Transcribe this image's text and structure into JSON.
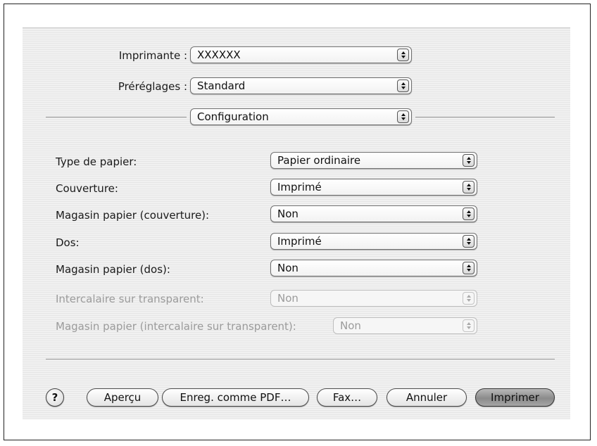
{
  "printer": {
    "label": "Imprimante :",
    "value": "XXXXXX"
  },
  "presets": {
    "label": "Préréglages :",
    "value": "Standard"
  },
  "panel": {
    "value": "Configuration"
  },
  "options": {
    "paper_type": {
      "label": "Type de papier:",
      "value": "Papier ordinaire"
    },
    "cover": {
      "label": "Couverture:",
      "value": "Imprimé"
    },
    "cover_tray": {
      "label": "Magasin papier (couverture):",
      "value": "Non"
    },
    "back": {
      "label": "Dos:",
      "value": "Imprimé"
    },
    "back_tray": {
      "label": "Magasin papier (dos):",
      "value": "Non"
    },
    "transparency_interleave": {
      "label": "Intercalaire sur transparent:",
      "value": "Non",
      "enabled": false
    },
    "transparency_tray": {
      "label": "Magasin papier (intercalaire sur transparent):",
      "value": "Non",
      "enabled": false
    }
  },
  "buttons": {
    "help": "?",
    "preview": "Aperçu",
    "save_pdf": "Enreg. comme PDF…",
    "fax": "Fax…",
    "cancel": "Annuler",
    "print": "Imprimer"
  },
  "icons": {
    "help": "question-mark-icon",
    "popup_arrows": "up-down-arrows-icon"
  }
}
